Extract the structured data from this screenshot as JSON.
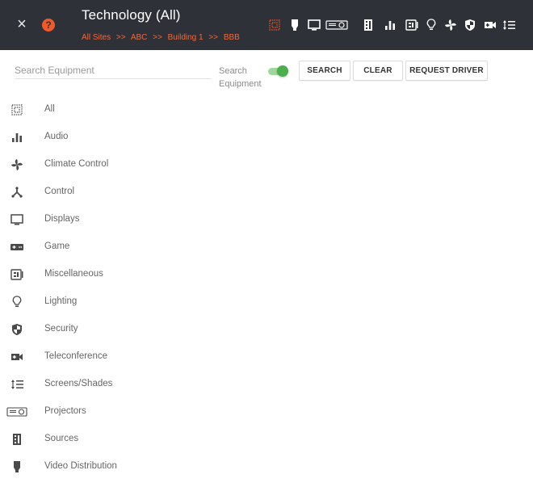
{
  "header": {
    "close_glyph": "×",
    "help_glyph": "?",
    "title": "Technology (All)",
    "breadcrumb": [
      "All Sites",
      ">>",
      "ABC",
      ">>",
      "Building 1",
      ">>",
      "BBB"
    ]
  },
  "toolbar_icons": [
    "all-icon",
    "video-distribution-icon",
    "display-icon",
    "projector-icon",
    "sources-icon",
    "audio-icon",
    "miscellaneous-icon",
    "lighting-icon",
    "climate-icon",
    "security-icon",
    "teleconference-icon",
    "screens-shades-icon"
  ],
  "search": {
    "placeholder": "Search Equipment",
    "value": "",
    "toggle_label_line1": "Search",
    "toggle_label_line2": "Equipment",
    "toggle_on": true,
    "search_button": "SEARCH",
    "clear_button": "CLEAR",
    "request_button": "REQUEST DRIVER"
  },
  "categories": [
    {
      "label": "All",
      "icon": "all-icon"
    },
    {
      "label": "Audio",
      "icon": "audio-icon"
    },
    {
      "label": "Climate Control",
      "icon": "climate-icon"
    },
    {
      "label": "Control",
      "icon": "control-icon"
    },
    {
      "label": "Displays",
      "icon": "display-icon"
    },
    {
      "label": "Game",
      "icon": "game-icon"
    },
    {
      "label": "Miscellaneous",
      "icon": "miscellaneous-icon"
    },
    {
      "label": "Lighting",
      "icon": "lighting-icon"
    },
    {
      "label": "Security",
      "icon": "security-icon"
    },
    {
      "label": "Teleconference",
      "icon": "teleconference-icon"
    },
    {
      "label": "Screens/Shades",
      "icon": "screens-shades-icon"
    },
    {
      "label": "Projectors",
      "icon": "projector-icon"
    },
    {
      "label": "Sources",
      "icon": "sources-icon"
    },
    {
      "label": "Video Distribution",
      "icon": "video-distribution-icon"
    }
  ],
  "colors": {
    "header_bg": "#2f3139",
    "accent": "#f05a28",
    "toggle_on": "#4cae4c"
  }
}
